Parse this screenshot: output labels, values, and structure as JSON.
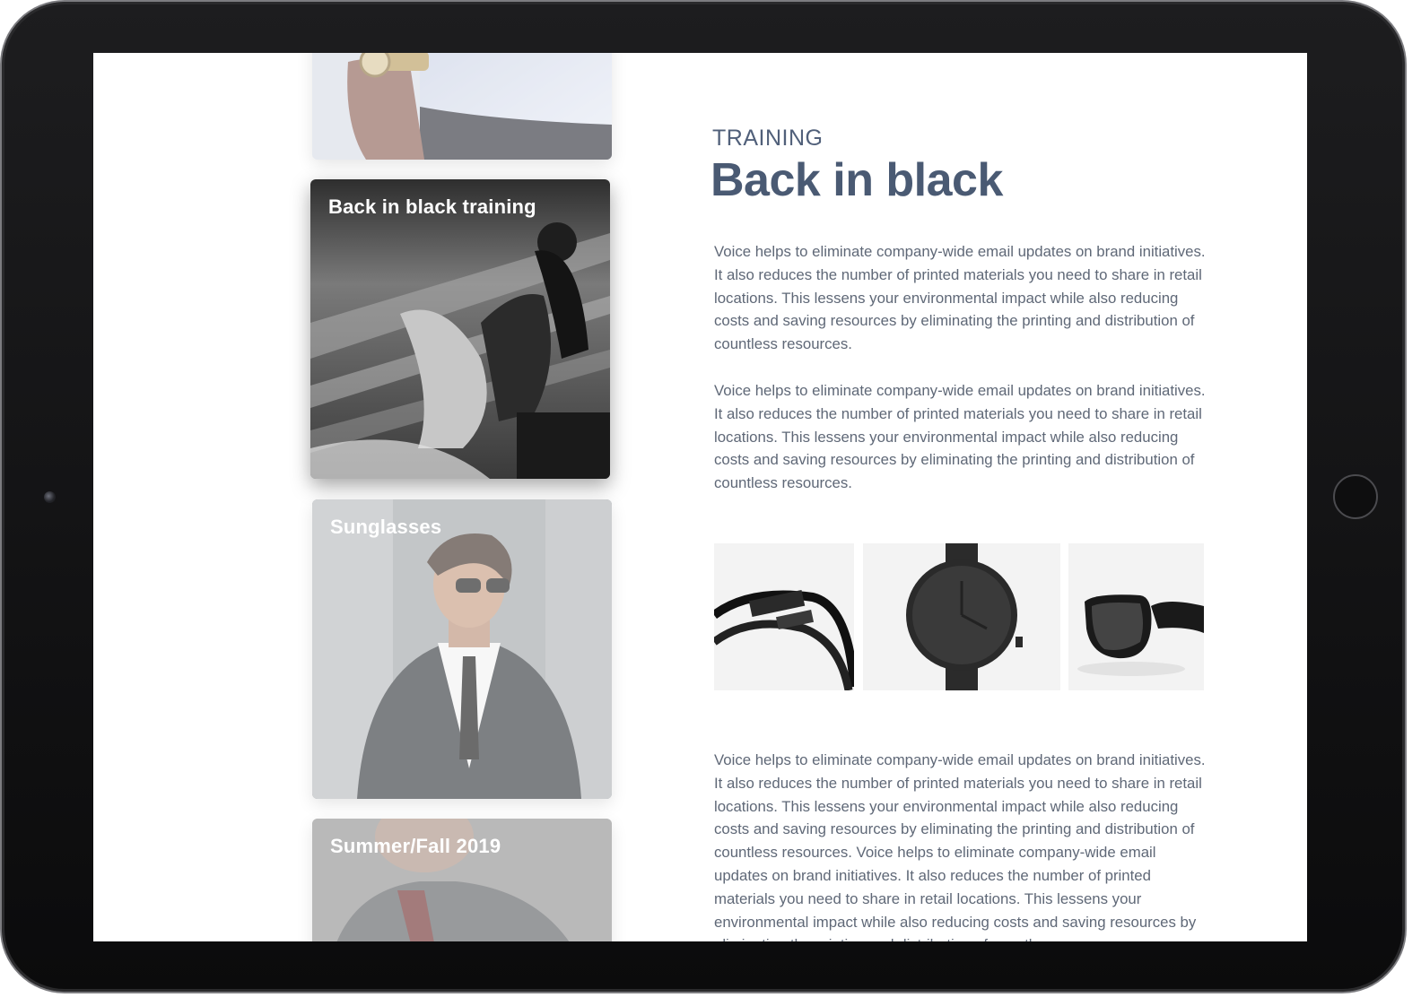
{
  "article": {
    "subtitle": "TRAINING",
    "title": "Back in black",
    "paragraphs": [
      "Voice helps to eliminate company-wide email updates on brand initiatives. It also reduces the number of printed materials you need to share in retail locations. This lessens your environmental impact while also reducing costs and saving resources by eliminating the printing and distribution of countless resources.",
      "Voice helps to eliminate company-wide email updates on brand initiatives. It also reduces the number of printed materials you need to share in retail locations. This lessens your environmental impact while also reducing costs and saving resources by eliminating the printing and distribution of countless resources.",
      "Voice helps to eliminate company-wide email updates on brand initiatives. It also reduces the number of printed materials you need to share in retail locations. This lessens your environmental impact while also reducing costs and saving resources by eliminating the printing and distribution of countless resources. Voice helps to eliminate company-wide email updates on brand initiatives. It also reduces the number of printed materials you need to share in retail locations. This lessens your environmental impact while also reducing costs and saving resources by eliminating the printing and distribution of countless resources."
    ],
    "product_images": [
      "bracelet",
      "watch",
      "sunglasses"
    ]
  },
  "cards": [
    {
      "label": ""
    },
    {
      "label": "Back in black training"
    },
    {
      "label": "Sunglasses"
    },
    {
      "label": "Summer/Fall 2019"
    }
  ]
}
